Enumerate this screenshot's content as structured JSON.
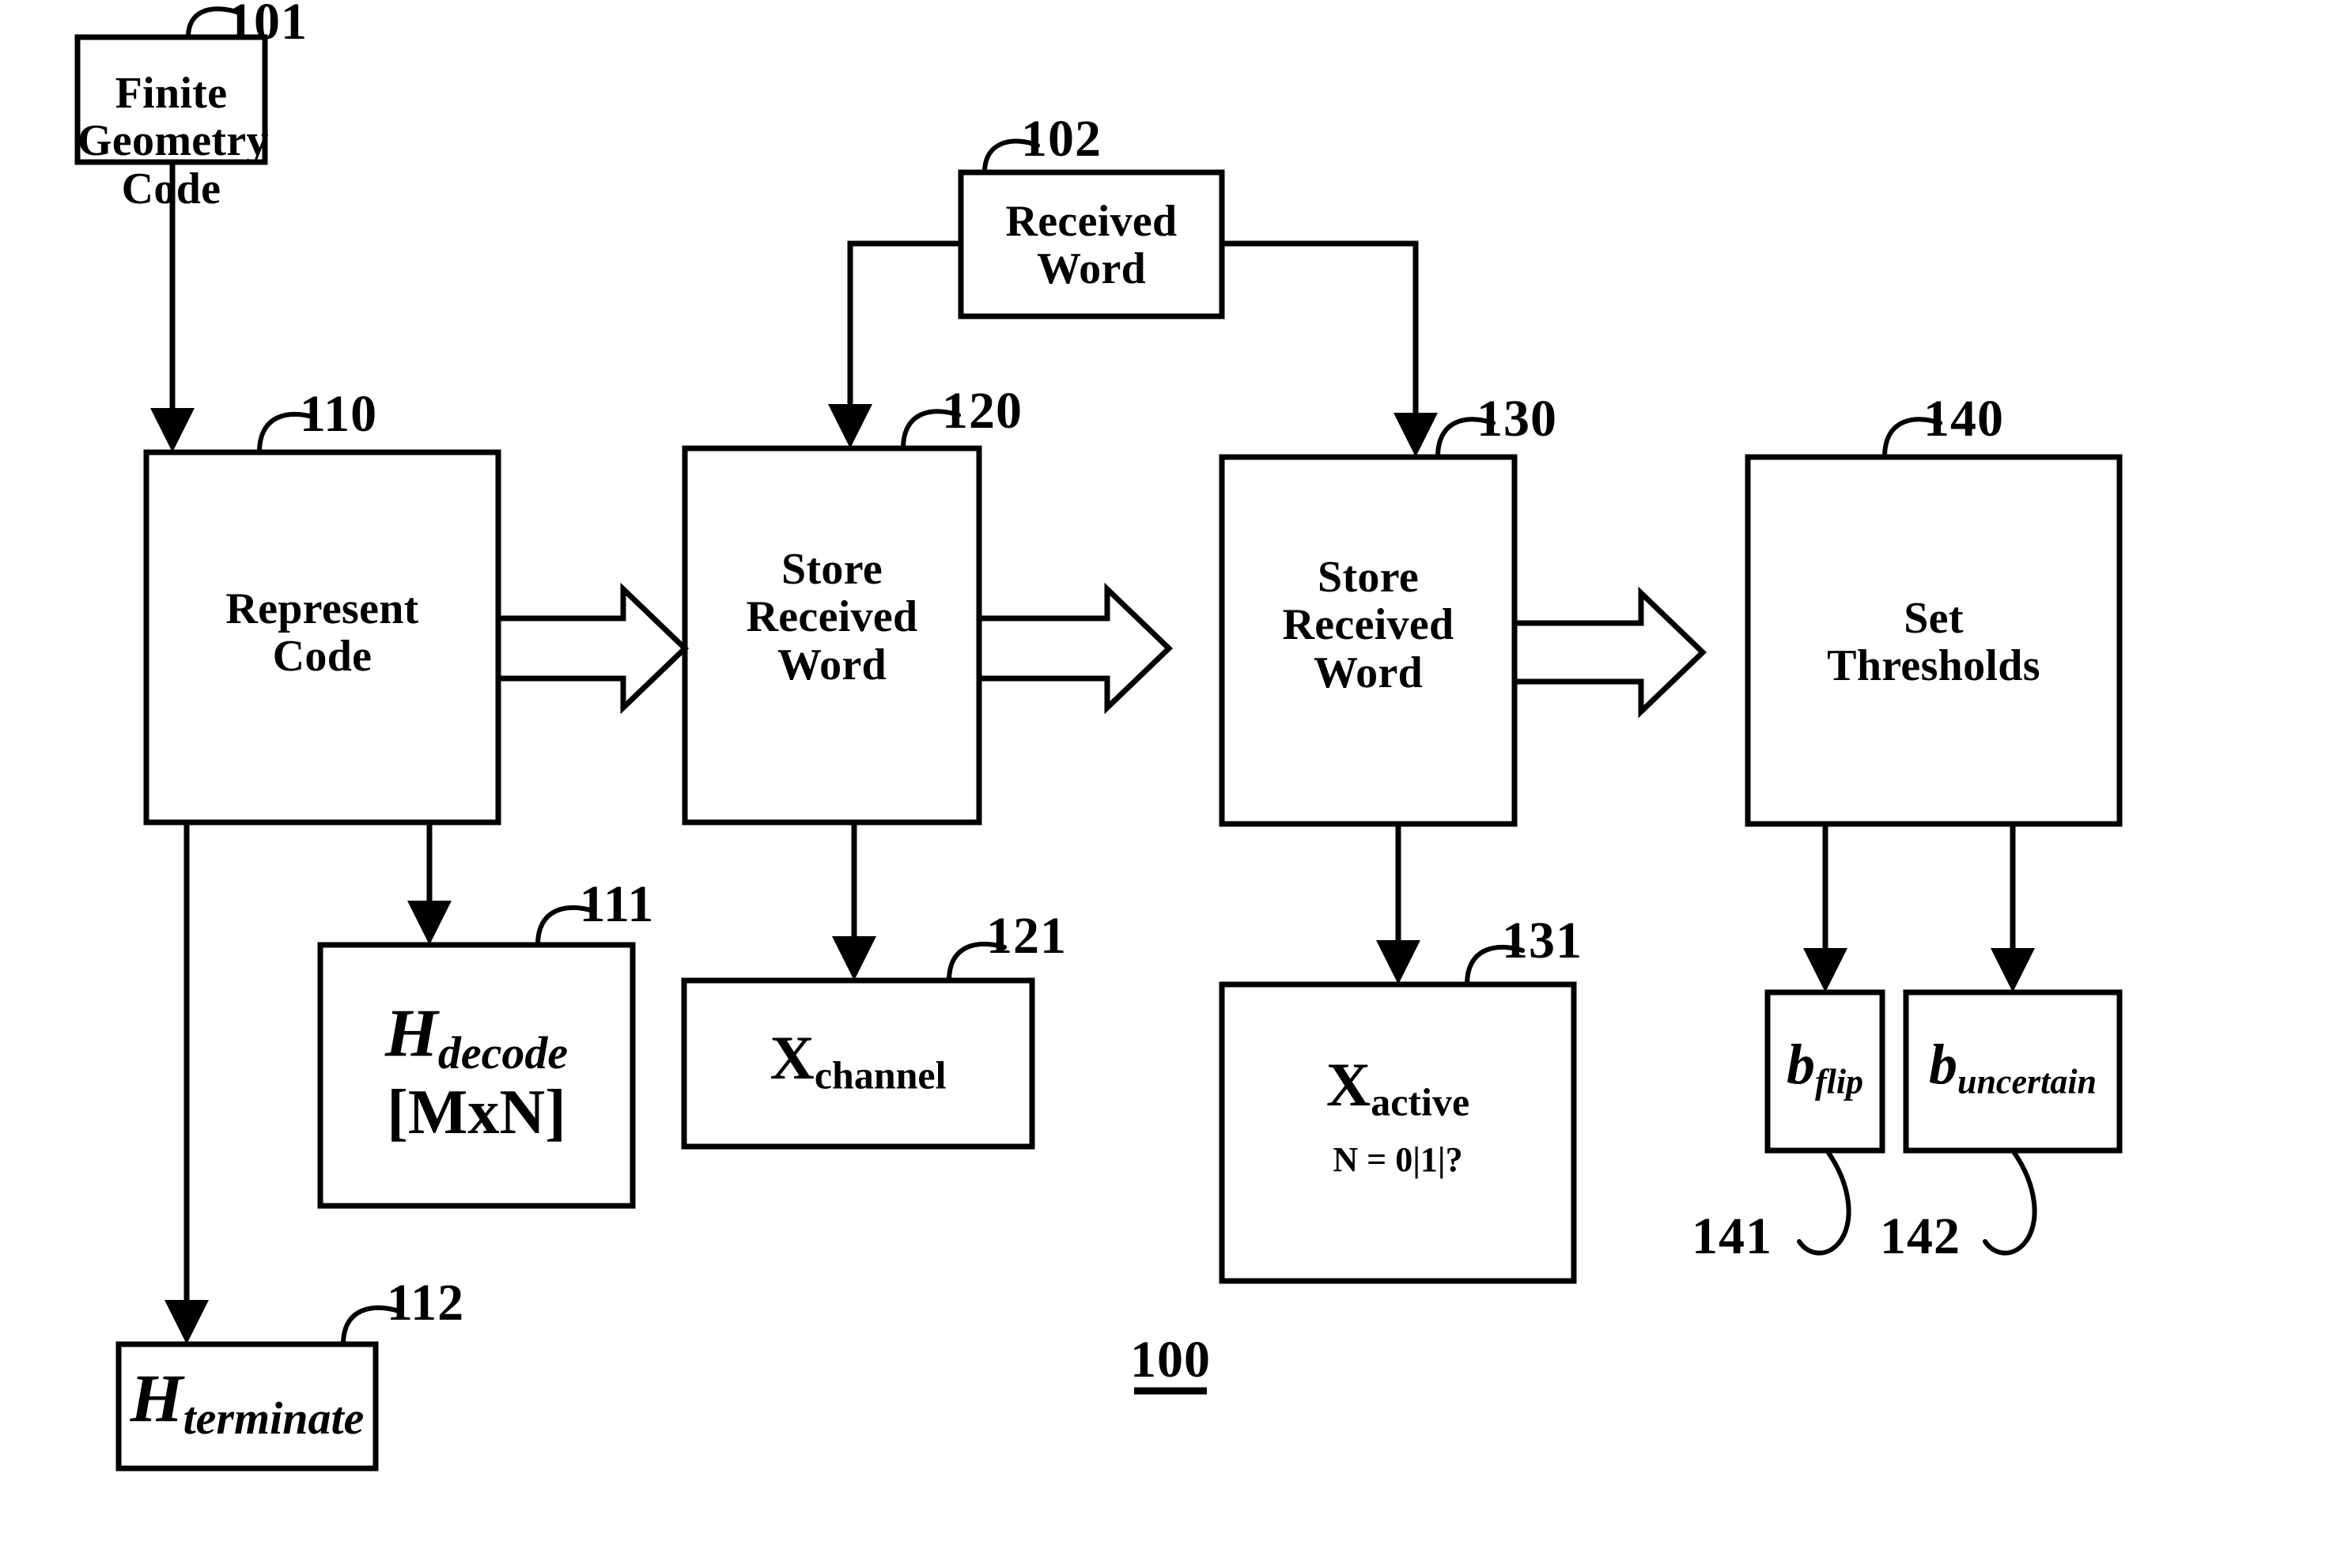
{
  "figure": {
    "number": "100",
    "title_ref": "100"
  },
  "boxes": {
    "b101": {
      "ref": "101",
      "lines": [
        "Finite",
        "Geometry",
        "Code"
      ]
    },
    "b102": {
      "ref": "102",
      "lines": [
        "Received",
        "Word"
      ]
    },
    "b110": {
      "ref": "110",
      "lines": [
        "Represent",
        "Code"
      ]
    },
    "b120": {
      "ref": "120",
      "lines": [
        "Store",
        "Received",
        "Word"
      ]
    },
    "b130": {
      "ref": "130",
      "lines": [
        "Store",
        "Received",
        "Word"
      ]
    },
    "b140": {
      "ref": "140",
      "lines": [
        "Set",
        "Thresholds"
      ]
    },
    "b111": {
      "ref": "111",
      "base": "H",
      "sub": "decode",
      "second_line": "[MxN]"
    },
    "b112": {
      "ref": "112",
      "base": "H",
      "sub": "terminate"
    },
    "b121": {
      "ref": "121",
      "base": "X",
      "sub": "channel"
    },
    "b131": {
      "ref": "131",
      "base": "X",
      "sub": "active",
      "second_line": "N = 0|1|?"
    },
    "b141": {
      "ref": "141",
      "base": "b",
      "sub": "flip"
    },
    "b142": {
      "ref": "142",
      "base": "b",
      "sub": "uncertain"
    }
  },
  "colors": {
    "ink": "#000000",
    "paper": "#ffffff"
  }
}
